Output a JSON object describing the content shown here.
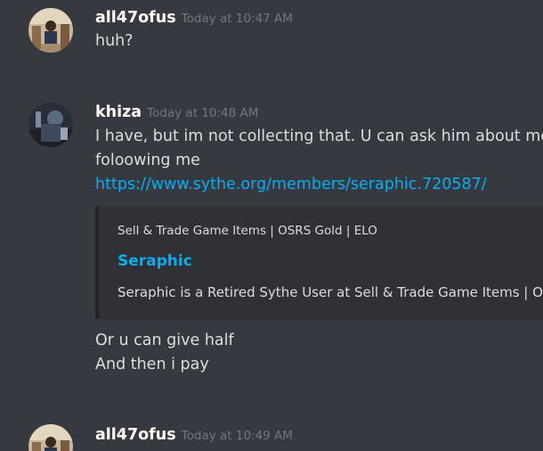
{
  "messages": [
    {
      "username": "all47ofus",
      "timestamp": "Today at 10:47 AM",
      "lines": [
        "huh?"
      ]
    },
    {
      "username": "khiza",
      "timestamp": "Today at 10:48 AM",
      "lines": [
        "I have, but im not collecting that. U can ask him about me, he",
        "foloowing me"
      ],
      "link": "https://www.sythe.org/members/seraphic.720587/",
      "embed": {
        "provider": "Sell & Trade Game Items | OSRS Gold | ELO",
        "title": "Seraphic",
        "description": "Seraphic is a Retired Sythe User at Sell & Trade Game Items | OSRS"
      },
      "after_lines": [
        "Or u can give half",
        "And then i pay"
      ]
    },
    {
      "username": "all47ofus",
      "timestamp": "Today at 10:49 AM",
      "lines": []
    }
  ],
  "colors": {
    "background": "#36393f",
    "username": "#ffffff",
    "timestamp": "#72767d",
    "text": "#dcddde",
    "link": "#00b0f4",
    "embed_bg": "#2f3136"
  }
}
